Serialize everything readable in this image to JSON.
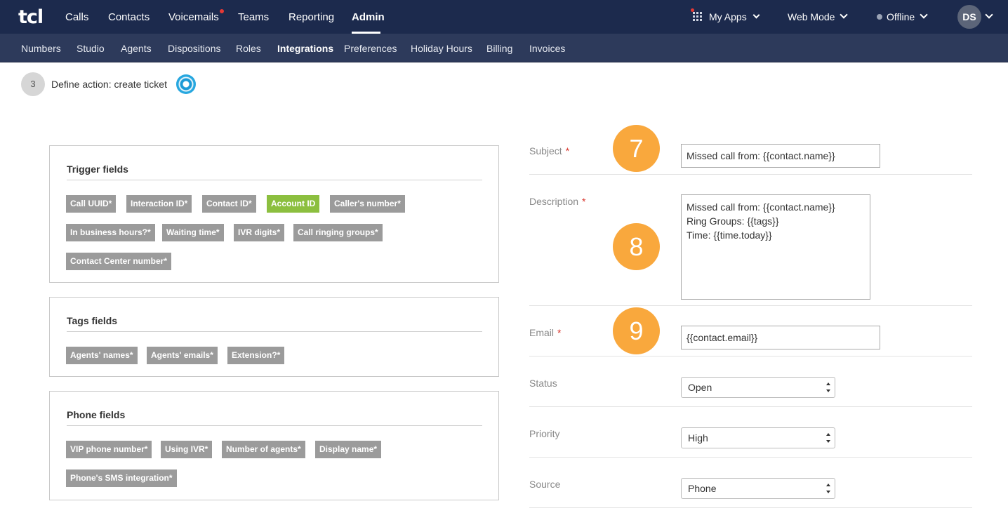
{
  "brand": {
    "logo_text": "tcl"
  },
  "topnav": {
    "items": [
      "Calls",
      "Contacts",
      "Voicemails",
      "Teams",
      "Reporting",
      "Admin"
    ],
    "active": "Admin",
    "my_apps": "My Apps",
    "web_mode": "Web Mode",
    "status": "Offline",
    "avatar": "DS"
  },
  "subnav": {
    "items": [
      "Numbers",
      "Studio",
      "Agents",
      "Dispositions",
      "Roles",
      "Integrations",
      "Preferences",
      "Holiday Hours",
      "Billing",
      "Invoices"
    ],
    "active": "Integrations"
  },
  "step": {
    "number": "3",
    "title": "Define action: create ticket"
  },
  "trigger_fields": {
    "title": "Trigger fields",
    "tags": [
      "Call UUID*",
      "Interaction ID*",
      "Contact ID*",
      "Account ID",
      "Caller's number*",
      "In business hours?*",
      "Waiting time*",
      "IVR digits*",
      "Call ringing groups*",
      "Contact Center number*"
    ]
  },
  "tags_fields": {
    "title": "Tags fields",
    "tags": [
      "Agents' names*",
      "Agents' emails*",
      "Extension?*"
    ]
  },
  "phone_fields": {
    "title": "Phone fields",
    "tags": [
      "VIP phone number*",
      "Using IVR*",
      "Number of agents*",
      "Display name*",
      "Phone's SMS integration*"
    ]
  },
  "form": {
    "subject": {
      "label": "Subject",
      "required": "*",
      "value": "Missed call from: {{contact.name}}"
    },
    "description": {
      "label": "Description",
      "required": "*",
      "lines": [
        "Missed call from: {{contact.name}}",
        "Ring Groups: {{tags}}",
        "Time: {{time.today}}"
      ]
    },
    "email": {
      "label": "Email",
      "required": "*",
      "value": "{{contact.email}}"
    },
    "status": {
      "label": "Status",
      "value": "Open"
    },
    "priority": {
      "label": "Priority",
      "value": "High"
    },
    "source": {
      "label": "Source",
      "value": "Phone"
    }
  },
  "badges": [
    "7",
    "8",
    "9"
  ],
  "colors": {
    "topbar": "#1c2a4d",
    "subbar": "#2d3a5b",
    "tag": "#9b9b9b",
    "tag_highlight": "#8cbf3f",
    "badge": "#f9a83d",
    "required": "#d9342b"
  }
}
